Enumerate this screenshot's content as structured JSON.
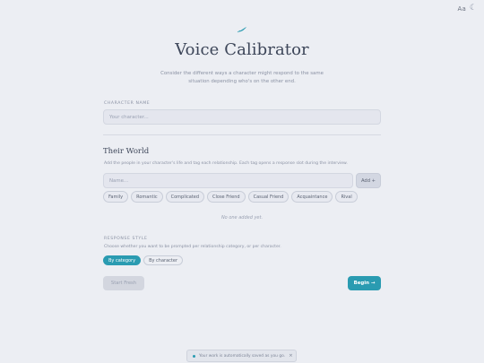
{
  "topbar": {
    "font_toggle": "Aa",
    "theme_icon": "moon-icon"
  },
  "header": {
    "logo_icon": "feather-icon",
    "title": "Voice Calibrator",
    "subtitle": "Consider the different ways a character might respond to the same situation depending who's on the other end."
  },
  "character": {
    "label": "CHARACTER NAME",
    "placeholder": "Your character..."
  },
  "world": {
    "title": "Their World",
    "description": "Add the people in your character's life and tag each relationship. Each tag opens a response slot during the interview.",
    "name_placeholder": "Name...",
    "add_label": "Add +",
    "tags": [
      "Family",
      "Romantic",
      "Complicated",
      "Close Friend",
      "Casual Friend",
      "Acquaintance",
      "Rival"
    ],
    "empty_note": "No one added yet."
  },
  "response_style": {
    "label": "RESPONSE STYLE",
    "description": "Choose whether you want to be prompted per relationship category, or per character.",
    "options": [
      "By category",
      "By character"
    ],
    "selected": "By category"
  },
  "actions": {
    "start_fresh": "Start Fresh",
    "begin": "Begin →"
  },
  "toast": {
    "text": "Your work is automatically saved as you go.",
    "close": "×"
  },
  "colors": {
    "accent": "#2a9bb1",
    "background": "#eceef3",
    "text": "#3d4659"
  }
}
